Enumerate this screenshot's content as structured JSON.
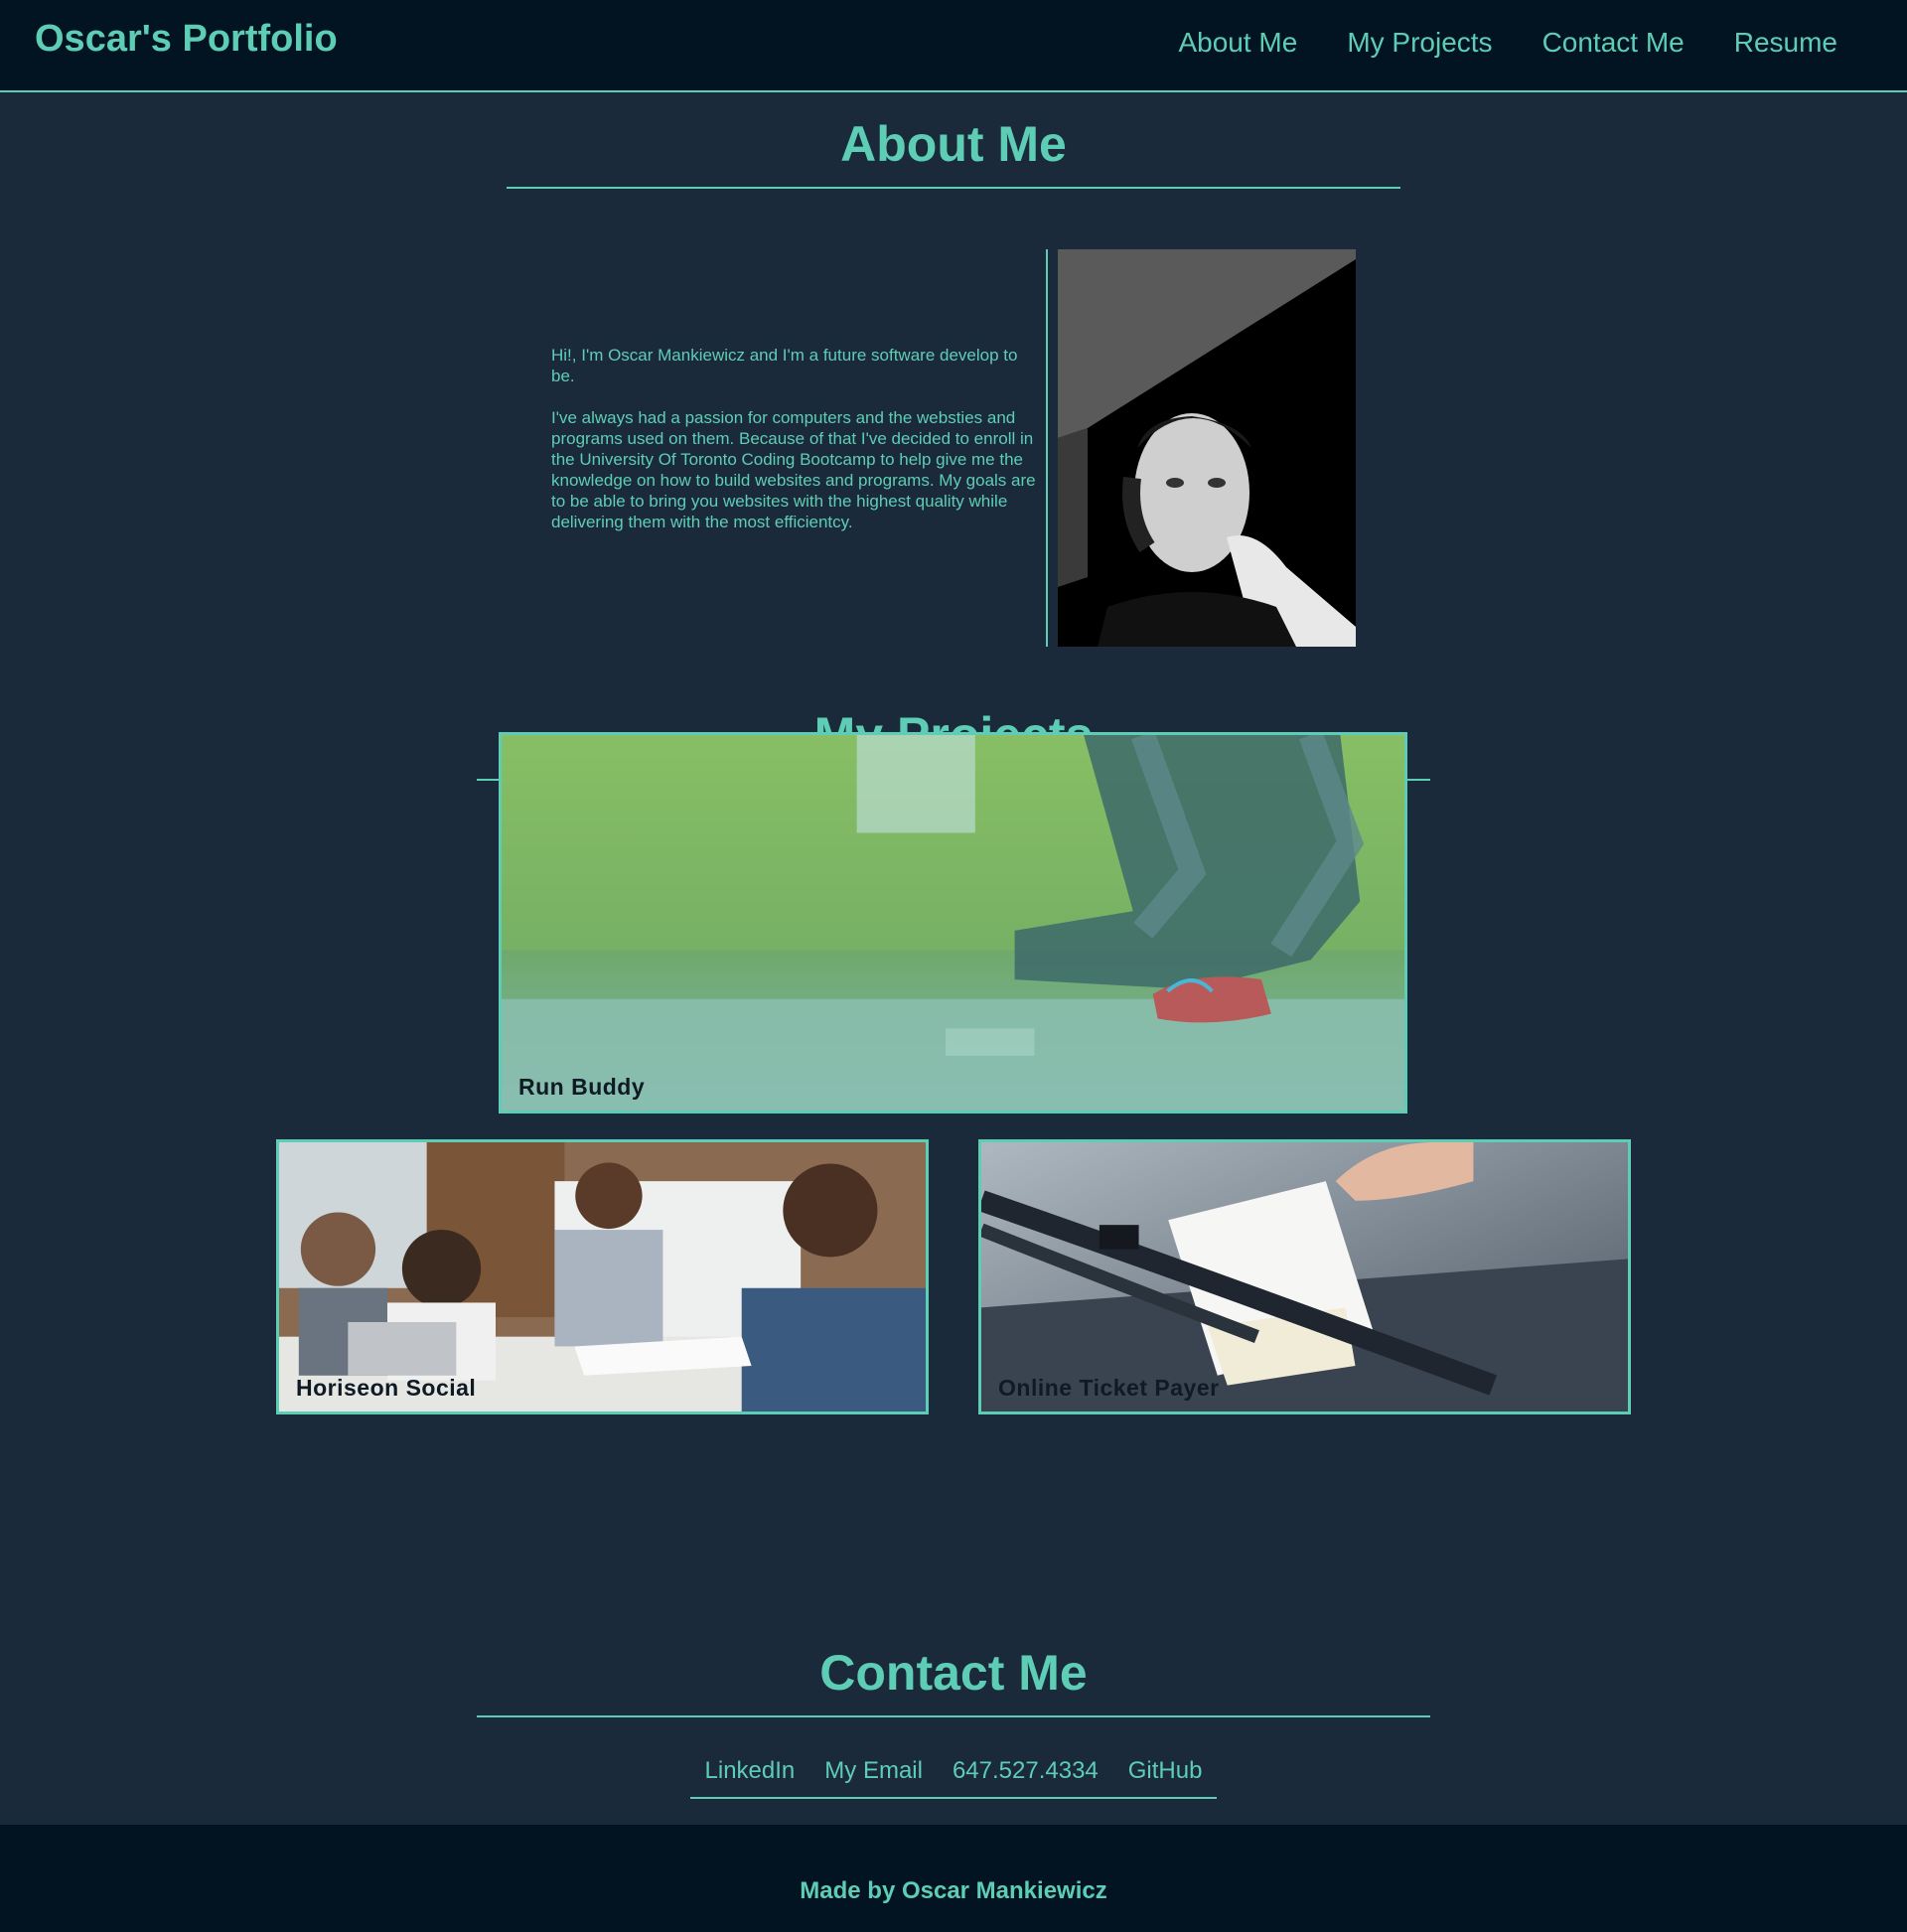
{
  "header": {
    "brand": "Oscar's Portfolio",
    "nav": [
      "About Me",
      "My Projects",
      "Contact Me",
      "Resume"
    ]
  },
  "about": {
    "title": "About Me",
    "paragraph1": "Hi!, I'm Oscar Mankiewicz and I'm a future software develop to be.",
    "paragraph2": "I've always had a passion for computers and the websties and programs used on them. Because of that I've decided to enroll in the University Of Toronto Coding Bootcamp to help give me the knowledge on how to build websites and programs. My goals are to be able to bring you websites with the highest quality while delivering them with the most efficientcy."
  },
  "projects": {
    "title": "My Projects",
    "items": [
      "Run Buddy",
      "Horiseon Social",
      "Online Ticket Payer"
    ]
  },
  "contact": {
    "title": "Contact Me",
    "links": [
      "LinkedIn",
      "My Email",
      "647.527.4334",
      "GitHub"
    ]
  },
  "footer": {
    "text": "Made by Oscar Mankiewicz"
  },
  "colors": {
    "accent": "#5ecdb6",
    "background": "#1b2a3a",
    "header_bg": "#021421"
  }
}
